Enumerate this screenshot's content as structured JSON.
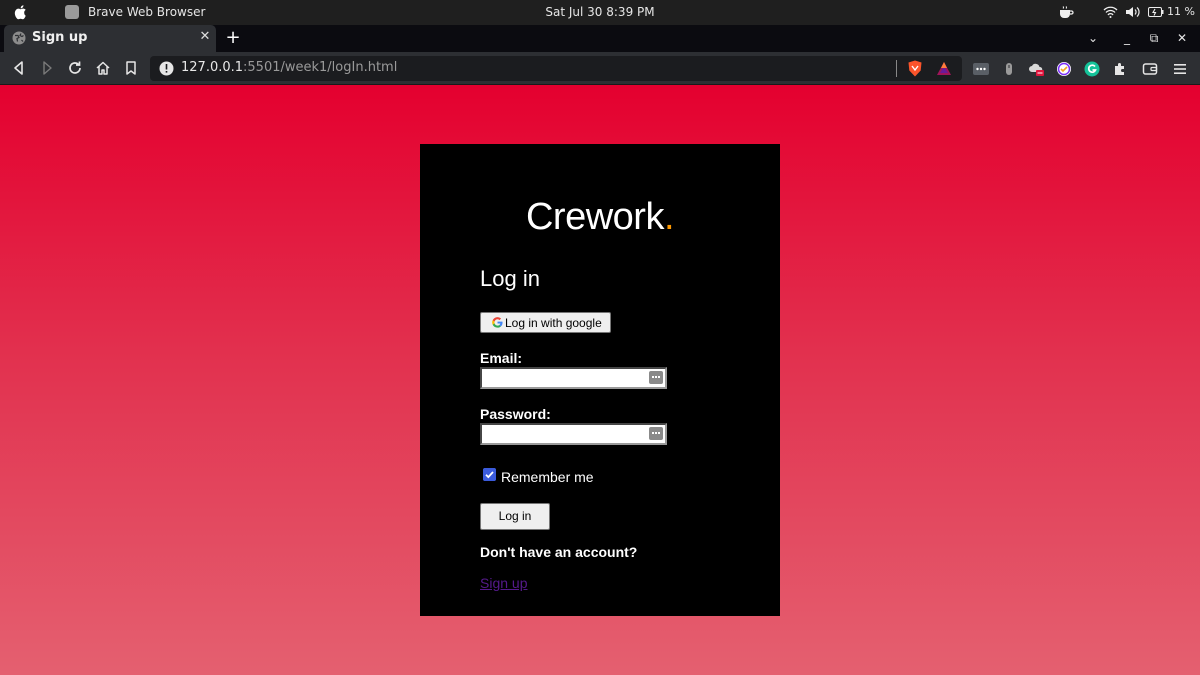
{
  "os_bar": {
    "app_name": "Brave Web Browser",
    "datetime": "Sat Jul 30   8:39 PM",
    "battery_text": "11 %"
  },
  "tabs": [
    {
      "title": "Sign up",
      "icon": "globe-icon",
      "active": true
    }
  ],
  "window_controls": {
    "tab_search": "⌄",
    "minimize": "_",
    "maximize": "⧉",
    "close": "✕"
  },
  "toolbar": {
    "url_host": "127.0.0.1",
    "url_rest": ":5501/week1/logIn.html"
  },
  "page": {
    "brand": "Crework",
    "brand_dot": ".",
    "heading": "Log in",
    "google_button": "Log in with google",
    "email_label": "Email:",
    "email_value": "",
    "password_label": "Password:",
    "password_value": "",
    "remember_label": "Remember me",
    "remember_checked": true,
    "login_button": "Log in",
    "no_account_text": "Don't have an account?",
    "signup_link": "Sign up"
  },
  "colors": {
    "gradient_top": "#e4002f",
    "gradient_bottom": "#e46070",
    "card_bg": "#000000",
    "brand_dot": "#ff9900",
    "link_visited": "#551a8b",
    "checkbox": "#3b5bdb"
  }
}
